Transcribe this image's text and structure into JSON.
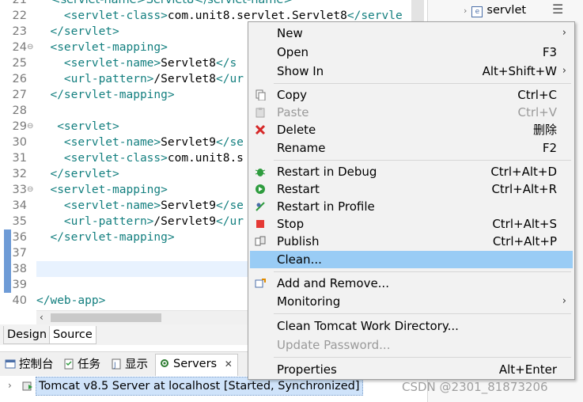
{
  "editor": {
    "lines": [
      {
        "num": "22",
        "fold": "",
        "indent": "    ",
        "parts": [
          [
            "tag",
            "<servlet-class>"
          ],
          [
            "txt",
            "com.unit8.servlet.Servlet8"
          ],
          [
            "tag",
            "</servle"
          ]
        ]
      },
      {
        "num": "23",
        "fold": "",
        "indent": "  ",
        "parts": [
          [
            "tag",
            "</servlet>"
          ]
        ]
      },
      {
        "num": "24",
        "fold": "⊖",
        "indent": "  ",
        "parts": [
          [
            "tag",
            "<servlet-mapping>"
          ]
        ]
      },
      {
        "num": "25",
        "fold": "",
        "indent": "    ",
        "parts": [
          [
            "tag",
            "<servlet-name>"
          ],
          [
            "txt",
            "Servlet8"
          ],
          [
            "tag",
            "</s"
          ]
        ]
      },
      {
        "num": "26",
        "fold": "",
        "indent": "    ",
        "parts": [
          [
            "tag",
            "<url-pattern>"
          ],
          [
            "txt",
            "/Servlet8"
          ],
          [
            "tag",
            "</ur"
          ]
        ]
      },
      {
        "num": "27",
        "fold": "",
        "indent": "  ",
        "parts": [
          [
            "tag",
            "</servlet-mapping>"
          ]
        ]
      },
      {
        "num": "28",
        "fold": "",
        "indent": "",
        "parts": []
      },
      {
        "num": "29",
        "fold": "⊖",
        "indent": "   ",
        "parts": [
          [
            "tag",
            "<servlet>"
          ]
        ]
      },
      {
        "num": "30",
        "fold": "",
        "indent": "    ",
        "parts": [
          [
            "tag",
            "<servlet-name>"
          ],
          [
            "txt",
            "Servlet9"
          ],
          [
            "tag",
            "</se"
          ]
        ]
      },
      {
        "num": "31",
        "fold": "",
        "indent": "    ",
        "parts": [
          [
            "tag",
            "<servlet-class>"
          ],
          [
            "txt",
            "com.unit8.s"
          ]
        ]
      },
      {
        "num": "32",
        "fold": "",
        "indent": "  ",
        "parts": [
          [
            "tag",
            "</servlet>"
          ]
        ]
      },
      {
        "num": "33",
        "fold": "⊖",
        "indent": "  ",
        "parts": [
          [
            "tag",
            "<servlet-mapping>"
          ]
        ]
      },
      {
        "num": "34",
        "fold": "",
        "indent": "    ",
        "parts": [
          [
            "tag",
            "<servlet-name>"
          ],
          [
            "txt",
            "Servlet9"
          ],
          [
            "tag",
            "</se"
          ]
        ]
      },
      {
        "num": "35",
        "fold": "",
        "indent": "    ",
        "parts": [
          [
            "tag",
            "<url-pattern>"
          ],
          [
            "txt",
            "/Servlet9"
          ],
          [
            "tag",
            "</ur"
          ]
        ]
      },
      {
        "num": "36",
        "fold": "",
        "indent": "  ",
        "parts": [
          [
            "tag",
            "</servlet-mapping>"
          ]
        ]
      },
      {
        "num": "37",
        "fold": "",
        "indent": "",
        "parts": []
      },
      {
        "num": "38",
        "fold": "",
        "indent": "",
        "parts": []
      },
      {
        "num": "39",
        "fold": "",
        "indent": "",
        "parts": []
      },
      {
        "num": "40",
        "fold": "",
        "indent": "",
        "parts": [
          [
            "tag",
            "</web-app>"
          ]
        ]
      }
    ],
    "top_partial": {
      "num": "21",
      "text": "    <servlet-name>Servlet8</servlet-name>"
    }
  },
  "editor_tabs": {
    "design": "Design",
    "source": "Source"
  },
  "panel_tabs": {
    "console": "控制台",
    "tasks": "任务",
    "display": "显示",
    "servers": "Servers",
    "close": "✕"
  },
  "server_row": {
    "label": "Tomcat v8.5 Server at localhost  [Started, Synchronized]"
  },
  "outline": {
    "item": "servlet"
  },
  "menu": {
    "items": [
      {
        "label": "New",
        "shortcut": "",
        "submenu": true
      },
      {
        "label": "Open",
        "shortcut": "F3"
      },
      {
        "label": "Show In",
        "shortcut": "Alt+Shift+W",
        "submenu": true
      },
      {
        "label": "Copy",
        "shortcut": "Ctrl+C",
        "icon": "copy-icon"
      },
      {
        "label": "Paste",
        "shortcut": "Ctrl+V",
        "icon": "paste-icon",
        "disabled": true
      },
      {
        "label": "Delete",
        "shortcut": "删除",
        "icon": "delete-icon"
      },
      {
        "label": "Rename",
        "shortcut": "F2"
      },
      {
        "label": "Restart in Debug",
        "shortcut": "Ctrl+Alt+D",
        "icon": "debug-icon"
      },
      {
        "label": "Restart",
        "shortcut": "Ctrl+Alt+R",
        "icon": "restart-icon"
      },
      {
        "label": "Restart in Profile",
        "shortcut": "",
        "icon": "profile-icon"
      },
      {
        "label": "Stop",
        "shortcut": "Ctrl+Alt+S",
        "icon": "stop-icon"
      },
      {
        "label": "Publish",
        "shortcut": "Ctrl+Alt+P",
        "icon": "publish-icon"
      },
      {
        "label": "Clean...",
        "shortcut": "",
        "highlighted": true
      },
      {
        "label": "Add and Remove...",
        "shortcut": "",
        "icon": "add-remove-icon"
      },
      {
        "label": "Monitoring",
        "shortcut": "",
        "submenu": true
      },
      {
        "label": "Clean Tomcat Work Directory...",
        "shortcut": ""
      },
      {
        "label": "Update Password...",
        "shortcut": "",
        "disabled": true
      },
      {
        "label": "Properties",
        "shortcut": "Alt+Enter"
      }
    ]
  },
  "watermark": "CSDN @2301_81873206",
  "colors": {
    "menu_highlight": "#99ccf5",
    "xml_tag": "#137f7f",
    "stop": "#e53935",
    "restart": "#2e9c3e",
    "delete": "#d62828"
  }
}
